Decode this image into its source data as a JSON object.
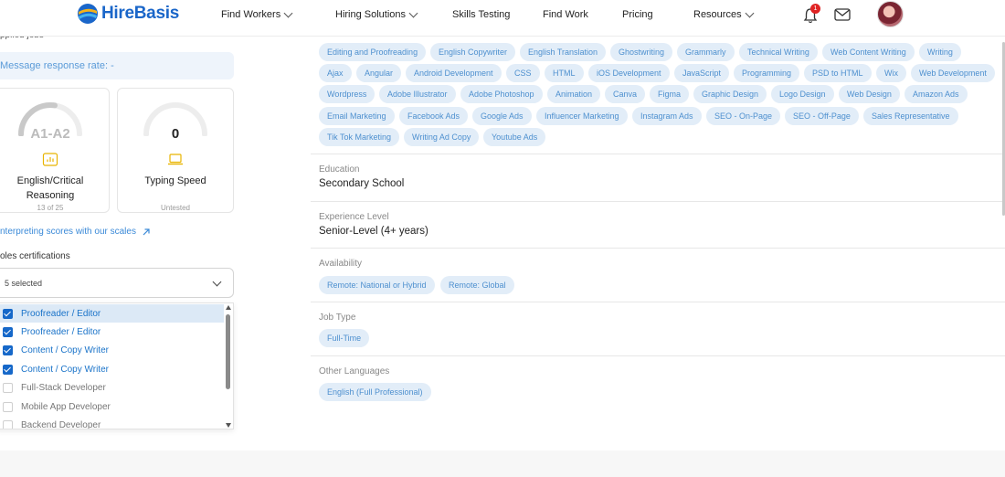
{
  "nav": {
    "logo_text": "HireBasis",
    "items": [
      {
        "label": "Find Workers",
        "has_dropdown": true
      },
      {
        "label": "Hiring Solutions",
        "has_dropdown": true
      },
      {
        "label": "Skills Testing",
        "has_dropdown": false
      },
      {
        "label": "Find Work",
        "has_dropdown": false
      },
      {
        "label": "Pricing",
        "has_dropdown": false
      },
      {
        "label": "Resources",
        "has_dropdown": true
      }
    ],
    "notification_count": "1",
    "icons": [
      "bell-icon",
      "mail-icon",
      "avatar"
    ]
  },
  "left": {
    "applied_jobs_label": "pplied jobs",
    "message_response": "Message response rate: -",
    "cards": [
      {
        "value": "A1-A2",
        "label": "English/Critical Reasoning",
        "sub": "13 of 25",
        "icon": "bar-chart-icon",
        "gauge_fraction": 0.55
      },
      {
        "value": "0",
        "label": "Typing Speed",
        "sub": "Untested",
        "icon": "laptop-icon",
        "gauge_fraction": 0
      }
    ],
    "interpret_link": "nterpreting scores with our scales",
    "roles_label": "oles certifications",
    "select_value": "5 selected",
    "dropdown_items": [
      {
        "label": "Proofreader / Editor",
        "checked": true,
        "highlighted": true
      },
      {
        "label": "Proofreader / Editor",
        "checked": true,
        "highlighted": false
      },
      {
        "label": "Content / Copy Writer",
        "checked": true,
        "highlighted": false
      },
      {
        "label": "Content / Copy Writer",
        "checked": true,
        "highlighted": false
      },
      {
        "label": "Full-Stack Developer",
        "checked": false,
        "highlighted": false
      },
      {
        "label": "Mobile App Developer",
        "checked": false,
        "highlighted": false
      },
      {
        "label": "Backend Developer",
        "checked": false,
        "highlighted": false
      }
    ]
  },
  "skills": [
    [
      "Editing and Proofreading",
      "English Copywriter",
      "English Translation",
      "Ghostwriting",
      "Grammarly",
      "Technical Writing",
      "Web Content Writing",
      "Writing"
    ],
    [
      "Ajax",
      "Angular",
      "Android Development",
      "CSS",
      "HTML",
      "iOS Development",
      "JavaScript",
      "Programming",
      "PSD to HTML",
      "Wix",
      "Web Development"
    ],
    [
      "Wordpress",
      "Adobe Illustrator",
      "Adobe Photoshop",
      "Animation",
      "Canva",
      "Figma",
      "Graphic Design",
      "Logo Design",
      "Web Design",
      "Amazon Ads"
    ],
    [
      "Email Marketing",
      "Facebook Ads",
      "Google Ads",
      "Influencer Marketing",
      "Instagram Ads",
      "SEO - On-Page",
      "SEO - Off-Page",
      "Sales Representative"
    ],
    [
      "Tik Tok Marketing",
      "Writing Ad Copy",
      "Youtube Ads"
    ]
  ],
  "education": {
    "label": "Education",
    "value": "Secondary School"
  },
  "experience": {
    "label": "Experience Level",
    "value": "Senior-Level (4+ years)"
  },
  "availability": {
    "label": "Availability",
    "chips": [
      "Remote: National or Hybrid",
      "Remote: Global"
    ]
  },
  "job_type": {
    "label": "Job Type",
    "chips": [
      "Full-Time"
    ]
  },
  "languages": {
    "label": "Other Languages",
    "chips": [
      "English (Full Professional)"
    ]
  },
  "colors": {
    "brand": "#1a66c9",
    "chip_bg": "#e2edf8",
    "chip_text": "#4e90cf",
    "checkbox": "#1668c9",
    "badge": "#e02424"
  }
}
